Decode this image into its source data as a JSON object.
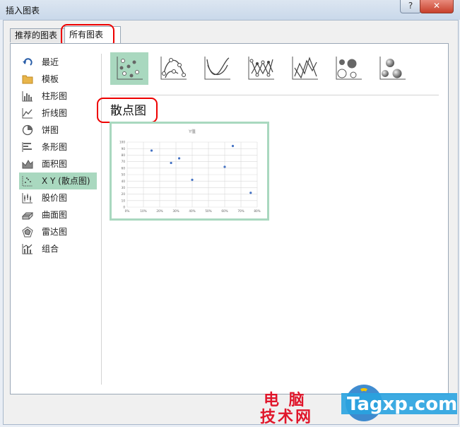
{
  "window": {
    "title": "插入图表",
    "help_label": "?",
    "close_label": "✕"
  },
  "tabs": [
    {
      "label": "推荐的图表",
      "active": false
    },
    {
      "label": "所有图表",
      "active": true
    }
  ],
  "sidebar": {
    "items": [
      {
        "label": "最近",
        "icon": "undo-arrow-icon"
      },
      {
        "label": "模板",
        "icon": "folder-icon"
      },
      {
        "label": "柱形图",
        "icon": "column-chart-icon"
      },
      {
        "label": "折线图",
        "icon": "line-chart-icon"
      },
      {
        "label": "饼图",
        "icon": "pie-chart-icon"
      },
      {
        "label": "条形图",
        "icon": "bar-chart-icon"
      },
      {
        "label": "面积图",
        "icon": "area-chart-icon"
      },
      {
        "label": "X Y (散点图)",
        "icon": "scatter-chart-icon",
        "selected": true
      },
      {
        "label": "股价图",
        "icon": "stock-chart-icon"
      },
      {
        "label": "曲面图",
        "icon": "surface-chart-icon"
      },
      {
        "label": "雷达图",
        "icon": "radar-chart-icon"
      },
      {
        "label": "组合",
        "icon": "combo-chart-icon"
      }
    ]
  },
  "subtypes": [
    {
      "icon": "scatter-icon",
      "selected": true
    },
    {
      "icon": "scatter-smooth-lines-markers-icon"
    },
    {
      "icon": "scatter-smooth-lines-icon"
    },
    {
      "icon": "scatter-straight-lines-markers-icon"
    },
    {
      "icon": "scatter-straight-lines-icon"
    },
    {
      "icon": "bubble-icon"
    },
    {
      "icon": "bubble-3d-icon"
    }
  ],
  "section_title": "散点图",
  "chart_data": {
    "type": "scatter",
    "title": "Y值",
    "x_tick_labels": [
      "0%",
      "10%",
      "20%",
      "30%",
      "40%",
      "50%",
      "60%",
      "70%",
      "80%"
    ],
    "y_tick_labels": [
      "0",
      "10",
      "20",
      "30",
      "40",
      "50",
      "60",
      "70",
      "80",
      "90",
      "100"
    ],
    "xlim": [
      0,
      0.8
    ],
    "ylim": [
      0,
      100
    ],
    "grid": true,
    "points": [
      {
        "x": 0.15,
        "y": 87
      },
      {
        "x": 0.27,
        "y": 68
      },
      {
        "x": 0.32,
        "y": 75
      },
      {
        "x": 0.4,
        "y": 42
      },
      {
        "x": 0.6,
        "y": 62
      },
      {
        "x": 0.65,
        "y": 94
      },
      {
        "x": 0.76,
        "y": 22
      }
    ],
    "point_color": "#4472c4"
  },
  "watermark": {
    "line1": "电 脑",
    "line2": "技术网",
    "brand": "Tagxp.com"
  },
  "colors": {
    "selected": "#a9d8bf",
    "highlight": "#e00000"
  }
}
